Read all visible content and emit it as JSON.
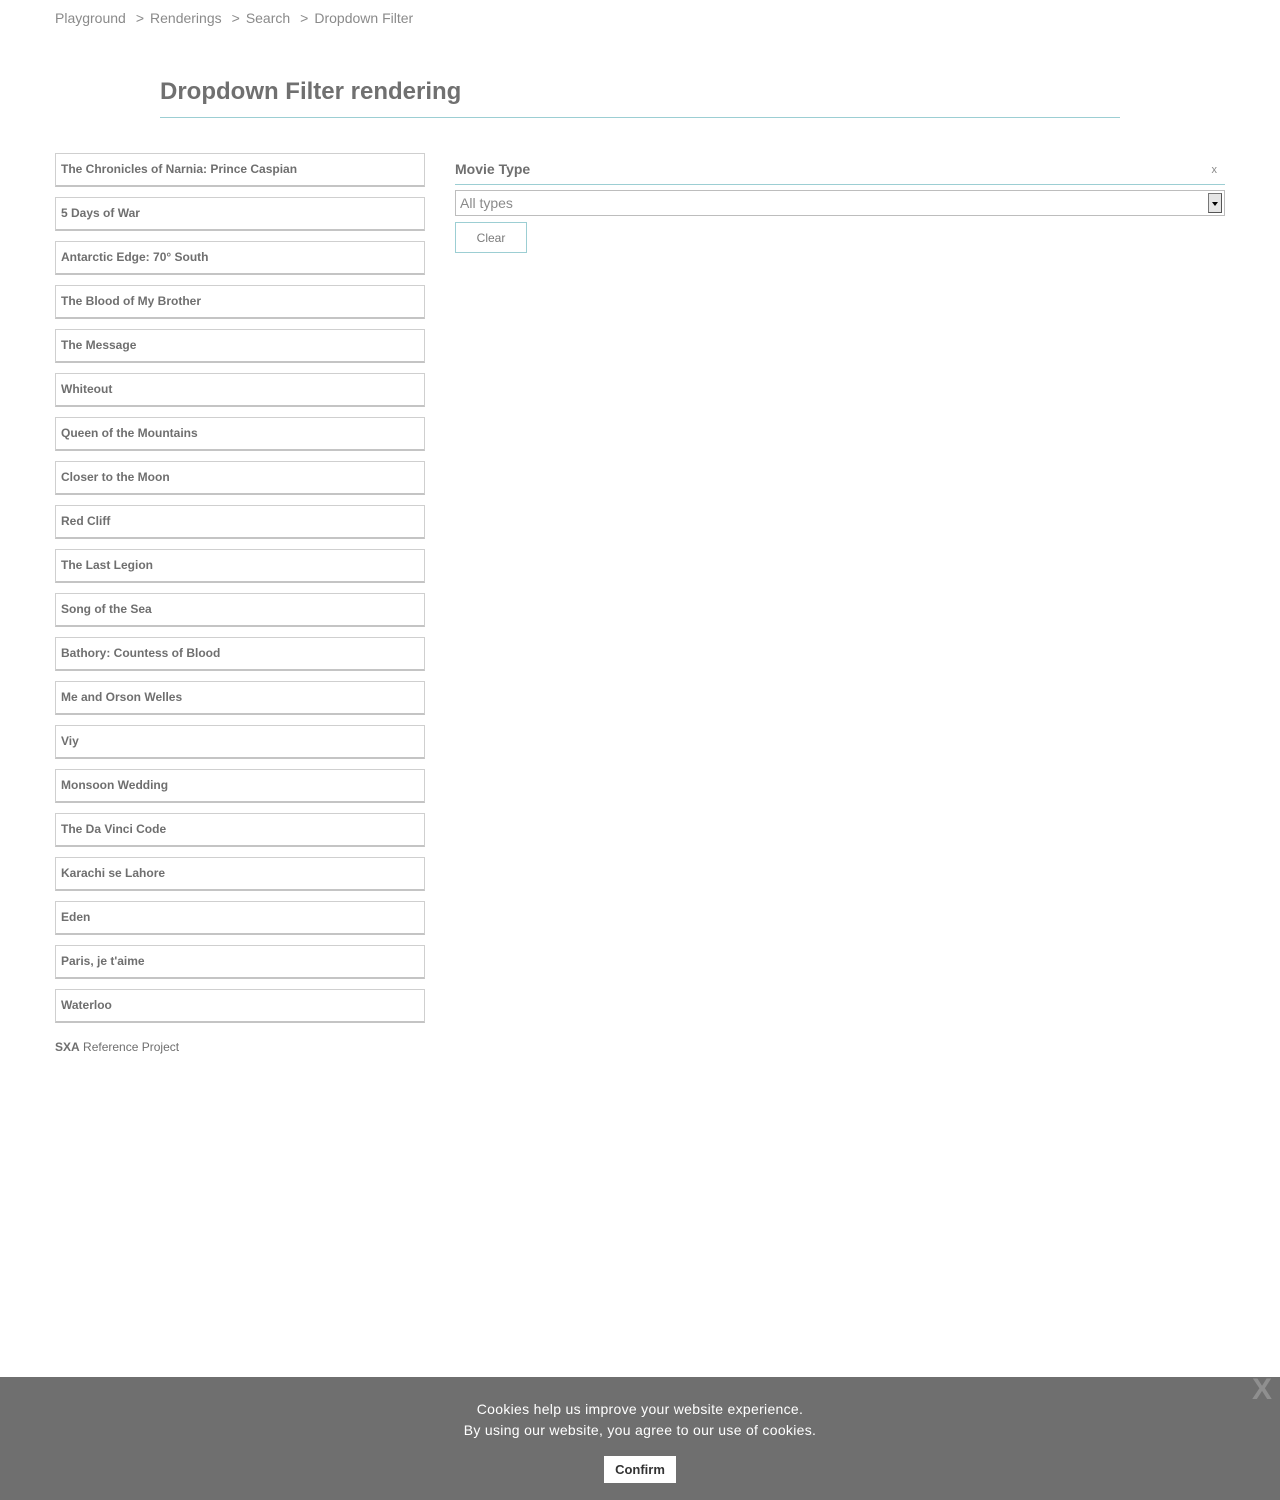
{
  "breadcrumb": [
    {
      "label": "Playground",
      "sep": ""
    },
    {
      "label": "Renderings",
      "sep": ">"
    },
    {
      "label": "Search",
      "sep": ">"
    },
    {
      "label": "Dropdown Filter",
      "sep": ">"
    }
  ],
  "page": {
    "title": "Dropdown Filter rendering"
  },
  "results": [
    "The Chronicles of Narnia: Prince Caspian",
    "5 Days of War",
    "Antarctic Edge: 70° South",
    "The Blood of My Brother",
    "The Message",
    "Whiteout",
    "Queen of the Mountains",
    "Closer to the Moon",
    "Red Cliff",
    "The Last Legion",
    "Song of the Sea",
    "Bathory: Countess of Blood",
    "Me and Orson Welles",
    "Viy",
    "Monsoon Wedding",
    "The Da Vinci Code",
    "Karachi se Lahore",
    "Eden",
    "Paris, je t'aime",
    "Waterloo"
  ],
  "filter": {
    "label": "Movie Type",
    "close_label": "x",
    "selected": "All types",
    "clear_label": "Clear"
  },
  "footer": {
    "brand": "SXA",
    "text": "Reference Project"
  },
  "cookie": {
    "line1": "Cookies help us improve your website experience.",
    "line2": "By using our website, you agree to our use of cookies.",
    "confirm_label": "Confirm",
    "close_label": "X"
  },
  "colors": {
    "accent_rule": "#9cced3",
    "cookie_bg": "#6f6f6f",
    "text": "#707070"
  }
}
